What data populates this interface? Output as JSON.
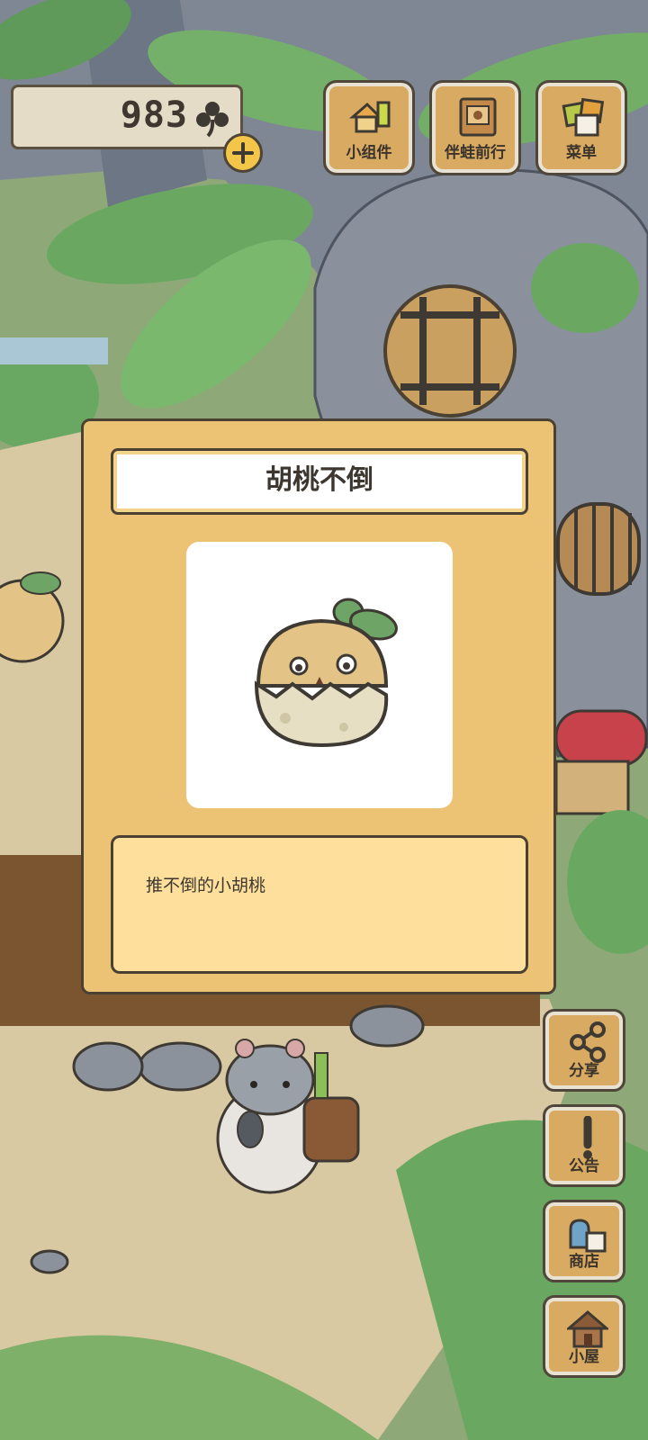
{
  "hud": {
    "clover_count": "983",
    "clover_icon": "clover-icon",
    "add_icon": "plus-icon"
  },
  "top_menu": [
    {
      "label": "小组件",
      "icon": "widget-icon"
    },
    {
      "label": "伴蛙前行",
      "icon": "notebook-icon"
    },
    {
      "label": "菜单",
      "icon": "menu-cards-icon"
    }
  ],
  "item_panel": {
    "title": "胡桃不倒",
    "description": "推不倒的小胡桃",
    "image": "walnut-doll-icon"
  },
  "side_menu": [
    {
      "label": "分享",
      "icon": "share-icon"
    },
    {
      "label": "公告",
      "icon": "exclamation-icon"
    },
    {
      "label": "商店",
      "icon": "shop-bags-icon"
    },
    {
      "label": "小屋",
      "icon": "house-icon"
    }
  ],
  "colors": {
    "panel_bg": "#ecc374",
    "description_bg": "#fedf9c",
    "button_wood": "#d9ab62",
    "coin_yellow": "#f3c64a"
  }
}
